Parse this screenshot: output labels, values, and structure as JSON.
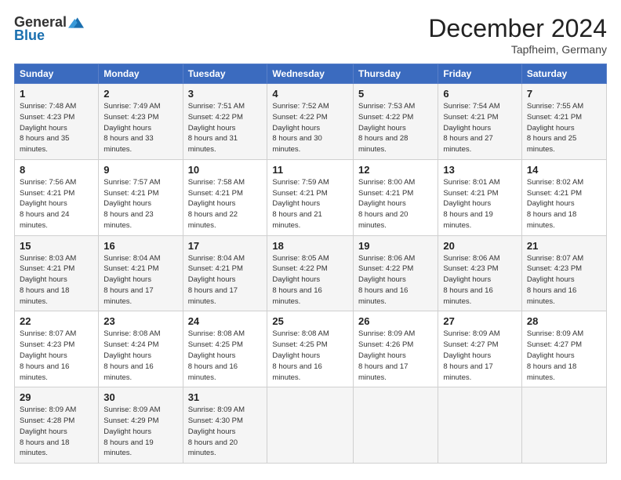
{
  "header": {
    "logo_general": "General",
    "logo_blue": "Blue",
    "month_title": "December 2024",
    "location": "Tapfheim, Germany"
  },
  "days_of_week": [
    "Sunday",
    "Monday",
    "Tuesday",
    "Wednesday",
    "Thursday",
    "Friday",
    "Saturday"
  ],
  "weeks": [
    [
      {
        "day": "1",
        "sunrise": "7:48 AM",
        "sunset": "4:23 PM",
        "daylight": "8 hours and 35 minutes."
      },
      {
        "day": "2",
        "sunrise": "7:49 AM",
        "sunset": "4:23 PM",
        "daylight": "8 hours and 33 minutes."
      },
      {
        "day": "3",
        "sunrise": "7:51 AM",
        "sunset": "4:22 PM",
        "daylight": "8 hours and 31 minutes."
      },
      {
        "day": "4",
        "sunrise": "7:52 AM",
        "sunset": "4:22 PM",
        "daylight": "8 hours and 30 minutes."
      },
      {
        "day": "5",
        "sunrise": "7:53 AM",
        "sunset": "4:22 PM",
        "daylight": "8 hours and 28 minutes."
      },
      {
        "day": "6",
        "sunrise": "7:54 AM",
        "sunset": "4:21 PM",
        "daylight": "8 hours and 27 minutes."
      },
      {
        "day": "7",
        "sunrise": "7:55 AM",
        "sunset": "4:21 PM",
        "daylight": "8 hours and 25 minutes."
      }
    ],
    [
      {
        "day": "8",
        "sunrise": "7:56 AM",
        "sunset": "4:21 PM",
        "daylight": "8 hours and 24 minutes."
      },
      {
        "day": "9",
        "sunrise": "7:57 AM",
        "sunset": "4:21 PM",
        "daylight": "8 hours and 23 minutes."
      },
      {
        "day": "10",
        "sunrise": "7:58 AM",
        "sunset": "4:21 PM",
        "daylight": "8 hours and 22 minutes."
      },
      {
        "day": "11",
        "sunrise": "7:59 AM",
        "sunset": "4:21 PM",
        "daylight": "8 hours and 21 minutes."
      },
      {
        "day": "12",
        "sunrise": "8:00 AM",
        "sunset": "4:21 PM",
        "daylight": "8 hours and 20 minutes."
      },
      {
        "day": "13",
        "sunrise": "8:01 AM",
        "sunset": "4:21 PM",
        "daylight": "8 hours and 19 minutes."
      },
      {
        "day": "14",
        "sunrise": "8:02 AM",
        "sunset": "4:21 PM",
        "daylight": "8 hours and 18 minutes."
      }
    ],
    [
      {
        "day": "15",
        "sunrise": "8:03 AM",
        "sunset": "4:21 PM",
        "daylight": "8 hours and 18 minutes."
      },
      {
        "day": "16",
        "sunrise": "8:04 AM",
        "sunset": "4:21 PM",
        "daylight": "8 hours and 17 minutes."
      },
      {
        "day": "17",
        "sunrise": "8:04 AM",
        "sunset": "4:21 PM",
        "daylight": "8 hours and 17 minutes."
      },
      {
        "day": "18",
        "sunrise": "8:05 AM",
        "sunset": "4:22 PM",
        "daylight": "8 hours and 16 minutes."
      },
      {
        "day": "19",
        "sunrise": "8:06 AM",
        "sunset": "4:22 PM",
        "daylight": "8 hours and 16 minutes."
      },
      {
        "day": "20",
        "sunrise": "8:06 AM",
        "sunset": "4:23 PM",
        "daylight": "8 hours and 16 minutes."
      },
      {
        "day": "21",
        "sunrise": "8:07 AM",
        "sunset": "4:23 PM",
        "daylight": "8 hours and 16 minutes."
      }
    ],
    [
      {
        "day": "22",
        "sunrise": "8:07 AM",
        "sunset": "4:23 PM",
        "daylight": "8 hours and 16 minutes."
      },
      {
        "day": "23",
        "sunrise": "8:08 AM",
        "sunset": "4:24 PM",
        "daylight": "8 hours and 16 minutes."
      },
      {
        "day": "24",
        "sunrise": "8:08 AM",
        "sunset": "4:25 PM",
        "daylight": "8 hours and 16 minutes."
      },
      {
        "day": "25",
        "sunrise": "8:08 AM",
        "sunset": "4:25 PM",
        "daylight": "8 hours and 16 minutes."
      },
      {
        "day": "26",
        "sunrise": "8:09 AM",
        "sunset": "4:26 PM",
        "daylight": "8 hours and 17 minutes."
      },
      {
        "day": "27",
        "sunrise": "8:09 AM",
        "sunset": "4:27 PM",
        "daylight": "8 hours and 17 minutes."
      },
      {
        "day": "28",
        "sunrise": "8:09 AM",
        "sunset": "4:27 PM",
        "daylight": "8 hours and 18 minutes."
      }
    ],
    [
      {
        "day": "29",
        "sunrise": "8:09 AM",
        "sunset": "4:28 PM",
        "daylight": "8 hours and 18 minutes."
      },
      {
        "day": "30",
        "sunrise": "8:09 AM",
        "sunset": "4:29 PM",
        "daylight": "8 hours and 19 minutes."
      },
      {
        "day": "31",
        "sunrise": "8:09 AM",
        "sunset": "4:30 PM",
        "daylight": "8 hours and 20 minutes."
      },
      null,
      null,
      null,
      null
    ]
  ]
}
